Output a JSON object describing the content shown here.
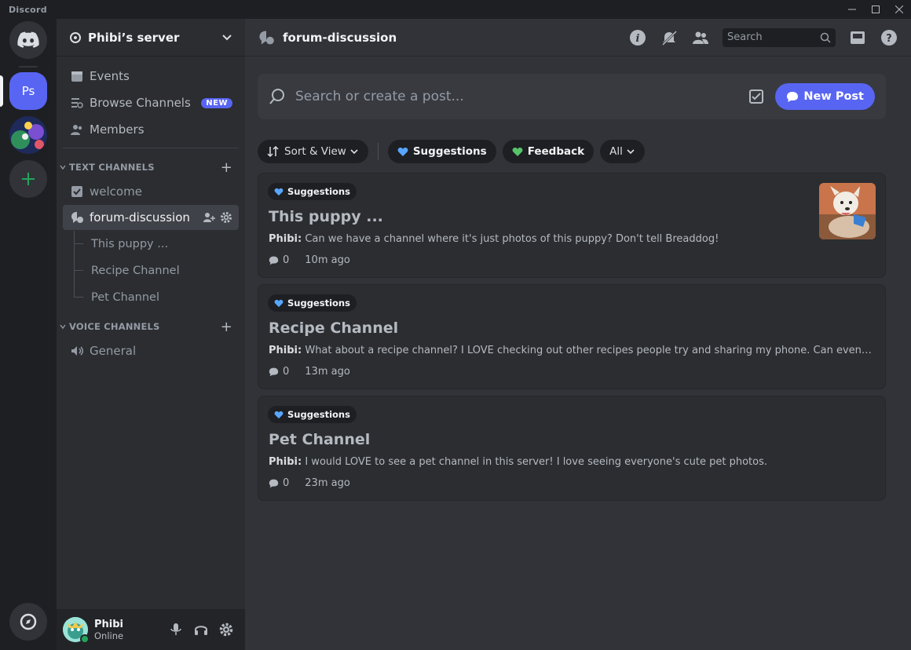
{
  "window": {
    "app_name": "Discord"
  },
  "rail": {
    "server_abbrev": "Ps"
  },
  "guild": {
    "name": "Phibi’s server"
  },
  "nav": [
    {
      "label": "Events"
    },
    {
      "label": "Browse Channels",
      "badge": "NEW"
    },
    {
      "label": "Members"
    }
  ],
  "text_category": {
    "label": "TEXT CHANNELS"
  },
  "text_channels": [
    {
      "label": "welcome"
    },
    {
      "label": "forum-discussion"
    }
  ],
  "threads": [
    {
      "label": "This puppy ..."
    },
    {
      "label": "Recipe Channel"
    },
    {
      "label": "Pet Channel"
    }
  ],
  "voice_category": {
    "label": "VOICE CHANNELS"
  },
  "voice_channels": [
    {
      "label": "General"
    }
  ],
  "user": {
    "name": "Phibi",
    "status": "Online"
  },
  "topbar": {
    "channel": "forum-discussion",
    "search_placeholder": "Search"
  },
  "forum": {
    "search_placeholder": "Search or create a post...",
    "new_post_label": "New Post",
    "filters": {
      "sort": "Sort & View",
      "tags": [
        {
          "label": "Suggestions",
          "color": "#58a6ff"
        },
        {
          "label": "Feedback",
          "color": "#57c46a"
        }
      ],
      "all": "All"
    },
    "posts": [
      {
        "tag": "Suggestions",
        "title": "This puppy ...",
        "author": "Phibi:",
        "snippet": "Can we have a channel where it's just photos of this puppy? Don't tell Breaddog!",
        "replies": "0",
        "time": "10m ago",
        "has_thumbnail": true
      },
      {
        "tag": "Suggestions",
        "title": "Recipe Channel",
        "author": "Phibi:",
        "snippet": "What about a recipe channel? I LOVE checking out other recipes people try and sharing my phone. Can even had a food channel",
        "replies": "0",
        "time": "13m ago",
        "has_thumbnail": false
      },
      {
        "tag": "Suggestions",
        "title": "Pet Channel",
        "author": "Phibi:",
        "snippet": "I would LOVE to see a pet channel in this server! I love seeing everyone's cute pet photos.",
        "replies": "0",
        "time": "23m ago",
        "has_thumbnail": false
      }
    ]
  },
  "colors": {
    "blurple": "#5865f2",
    "online": "#23a55a",
    "add_green": "#23a55a"
  }
}
